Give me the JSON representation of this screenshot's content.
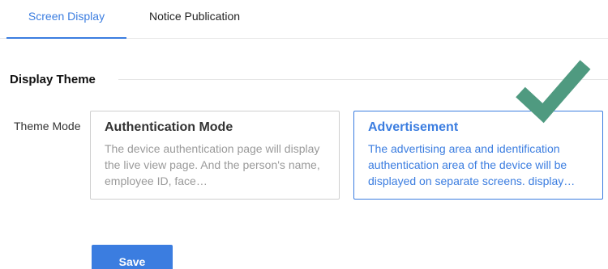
{
  "tabs": {
    "screen_display": "Screen Display",
    "notice_publication": "Notice Publication",
    "active": "Screen Display"
  },
  "section": {
    "title": "Display Theme"
  },
  "theme": {
    "label": "Theme Mode",
    "options": [
      {
        "title": "Authentication Mode",
        "description": "The device authentication page will display the live view page. And the person's name, employee ID, face…",
        "selected": false
      },
      {
        "title": "Advertisement",
        "description": "The advertising area and identification authentication area of the device will be displayed on separate screens. display…",
        "selected": true
      }
    ]
  },
  "actions": {
    "save_label": "Save"
  },
  "colors": {
    "accent": "#3b7de0",
    "check": "#4f9a80",
    "border": "#cfcfcf"
  },
  "icons": {
    "selected_indicator": "checkmark-icon"
  }
}
